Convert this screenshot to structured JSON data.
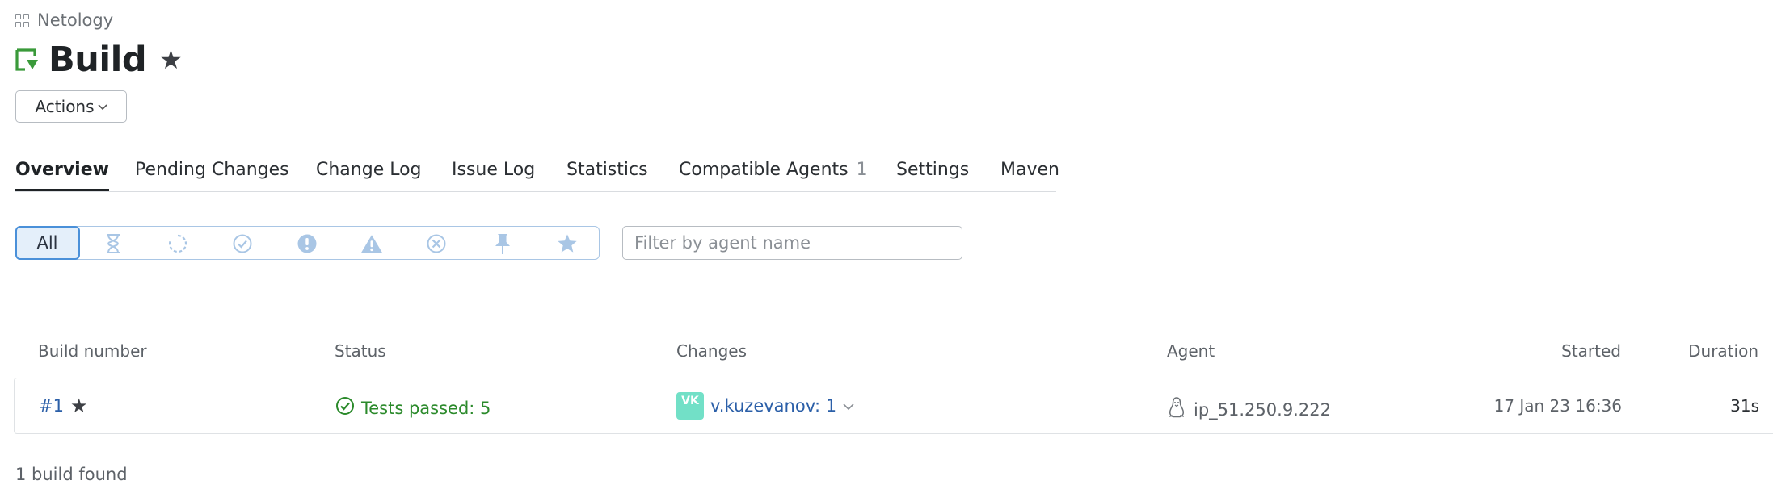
{
  "breadcrumb": {
    "project": "Netology"
  },
  "header": {
    "title": "Build"
  },
  "actions": {
    "label": "Actions"
  },
  "tabs": [
    {
      "label": "Overview"
    },
    {
      "label": "Pending Changes"
    },
    {
      "label": "Change Log"
    },
    {
      "label": "Issue Log"
    },
    {
      "label": "Statistics"
    },
    {
      "label": "Compatible Agents",
      "count": "1"
    },
    {
      "label": "Settings"
    },
    {
      "label": "Maven"
    }
  ],
  "filters": {
    "all_label": "All",
    "icons": [
      "hourglass-icon",
      "running-icon",
      "success-icon",
      "failed-icon",
      "warning-icon",
      "cancelled-icon",
      "pin-icon",
      "star-icon"
    ],
    "agent_placeholder": "Filter by agent name"
  },
  "table": {
    "headers": {
      "build_number": "Build number",
      "status": "Status",
      "changes": "Changes",
      "agent": "Agent",
      "started": "Started",
      "duration": "Duration"
    },
    "rows": [
      {
        "build_number": "#1",
        "status": "Tests passed: 5",
        "avatar_initials": "VK",
        "changes": "v.kuzevanov: 1",
        "agent": "ip_51.250.9.222",
        "started": "17 Jan 23 16:36",
        "duration": "31s"
      }
    ]
  },
  "footer": {
    "count_text": "1 build found"
  },
  "colors": {
    "accent": "#4a90d9",
    "success": "#2b8a2b",
    "link": "#2b5fa8",
    "avatar": "#72e0c7"
  }
}
